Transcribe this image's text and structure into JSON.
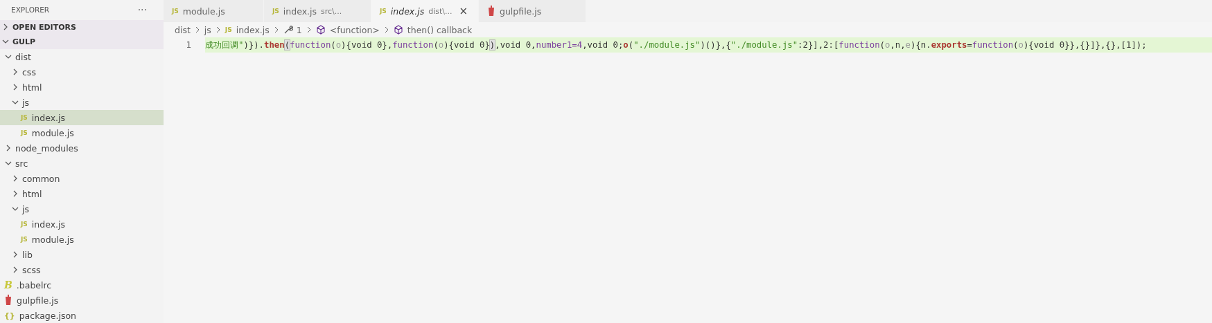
{
  "sidebar": {
    "title": "EXPLORER",
    "more": "···",
    "sections": [
      {
        "label": "OPEN EDITORS",
        "expanded": false
      },
      {
        "label": "GULP",
        "expanded": true
      }
    ],
    "tree": [
      {
        "label": "dist",
        "kind": "folder",
        "expanded": true,
        "selected": false,
        "children": [
          {
            "label": "css",
            "kind": "folder",
            "expanded": false,
            "selected": false
          },
          {
            "label": "html",
            "kind": "folder",
            "expanded": false,
            "selected": false
          },
          {
            "label": "js",
            "kind": "folder",
            "expanded": true,
            "selected": false,
            "children": [
              {
                "label": "index.js",
                "kind": "js",
                "badge": "JS",
                "selected": true
              },
              {
                "label": "module.js",
                "kind": "js",
                "badge": "JS",
                "selected": false
              }
            ]
          }
        ]
      },
      {
        "label": "node_modules",
        "kind": "folder",
        "expanded": false,
        "selected": false
      },
      {
        "label": "src",
        "kind": "folder",
        "expanded": true,
        "selected": false,
        "children": [
          {
            "label": "common",
            "kind": "folder",
            "expanded": false,
            "selected": false
          },
          {
            "label": "html",
            "kind": "folder",
            "expanded": false,
            "selected": false
          },
          {
            "label": "js",
            "kind": "folder",
            "expanded": true,
            "selected": false,
            "children": [
              {
                "label": "index.js",
                "kind": "js",
                "badge": "JS",
                "selected": false
              },
              {
                "label": "module.js",
                "kind": "js",
                "badge": "JS",
                "selected": false
              }
            ]
          },
          {
            "label": "lib",
            "kind": "folder",
            "expanded": false,
            "selected": false
          },
          {
            "label": "scss",
            "kind": "folder",
            "expanded": false,
            "selected": false
          }
        ]
      },
      {
        "label": ".babelrc",
        "kind": "babel",
        "badge": "B",
        "selected": false
      },
      {
        "label": "gulpfile.js",
        "kind": "gulp",
        "selected": false
      },
      {
        "label": "package.json",
        "kind": "json",
        "badge": "{}",
        "selected": false
      }
    ]
  },
  "tabs": [
    {
      "label": "module.js",
      "kind": "js",
      "badge": "JS",
      "selected": false,
      "preview": false
    },
    {
      "label": "index.js",
      "description": "src\\...",
      "kind": "js",
      "badge": "JS",
      "selected": false,
      "preview": false
    },
    {
      "label": "index.js",
      "description": "dist\\...",
      "kind": "js",
      "badge": "JS",
      "selected": true,
      "preview": true,
      "close": "×"
    },
    {
      "label": "gulpfile.js",
      "kind": "gulp",
      "selected": false,
      "preview": false
    }
  ],
  "breadcrumbs": [
    {
      "label": "dist",
      "kind": "folder"
    },
    {
      "label": "js",
      "kind": "folder"
    },
    {
      "label": "index.js",
      "kind": "js",
      "badge": "JS"
    },
    {
      "label": "1",
      "kind": "wrench"
    },
    {
      "label": "<function>",
      "kind": "cube"
    },
    {
      "label": "then() callback",
      "kind": "cube"
    }
  ],
  "editor": {
    "lines": [
      {
        "number": "1",
        "highlighted": true,
        "tokens": [
          {
            "text": "成功回调\"",
            "kind": "string"
          },
          {
            "text": ")}).",
            "kind": "plain"
          },
          {
            "text": "then",
            "kind": "method"
          },
          {
            "text": "(",
            "kind": "bracket"
          },
          {
            "text": "function",
            "kind": "keyword"
          },
          {
            "text": "(",
            "kind": "plain"
          },
          {
            "text": "o",
            "kind": "param"
          },
          {
            "text": "){void 0},",
            "kind": "plain"
          },
          {
            "text": "function",
            "kind": "keyword"
          },
          {
            "text": "(",
            "kind": "plain"
          },
          {
            "text": "o",
            "kind": "param"
          },
          {
            "text": "){void 0}",
            "kind": "plain"
          },
          {
            "text": ")",
            "kind": "bracket"
          },
          {
            "text": ",void 0,",
            "kind": "plain"
          },
          {
            "text": "number1=4",
            "kind": "keyword"
          },
          {
            "text": ",void 0;",
            "kind": "plain"
          },
          {
            "text": "o",
            "kind": "method"
          },
          {
            "text": "(",
            "kind": "plain"
          },
          {
            "text": "\"./module.js\"",
            "kind": "string"
          },
          {
            "text": ")()},{",
            "kind": "plain"
          },
          {
            "text": "\"./module.js\"",
            "kind": "string"
          },
          {
            "text": ":2}],2:[",
            "kind": "plain"
          },
          {
            "text": "function",
            "kind": "keyword"
          },
          {
            "text": "(",
            "kind": "plain"
          },
          {
            "text": "o",
            "kind": "param"
          },
          {
            "text": ",n,",
            "kind": "plain"
          },
          {
            "text": "e",
            "kind": "param"
          },
          {
            "text": "){n.",
            "kind": "plain"
          },
          {
            "text": "exports",
            "kind": "method"
          },
          {
            "text": "=",
            "kind": "plain"
          },
          {
            "text": "function",
            "kind": "keyword"
          },
          {
            "text": "(",
            "kind": "plain"
          },
          {
            "text": "o",
            "kind": "param"
          },
          {
            "text": "){void 0}},{}]},{},[1]);",
            "kind": "plain"
          }
        ]
      }
    ]
  }
}
